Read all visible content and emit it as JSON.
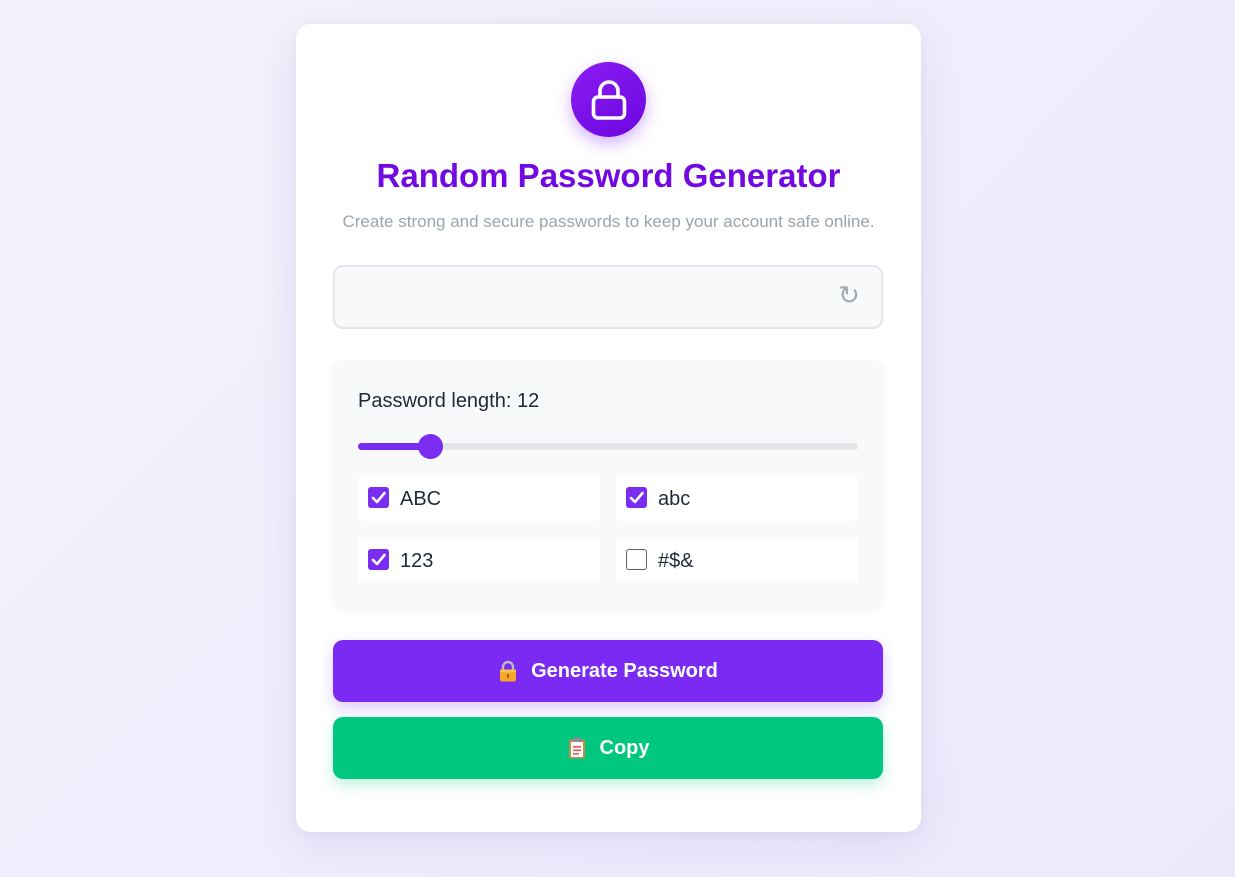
{
  "header": {
    "logo_icon": "lock-icon",
    "title": "Random Password Generator",
    "subtitle": "Create strong and secure passwords to keep your account safe online."
  },
  "password": {
    "value": "",
    "placeholder": "",
    "refresh_icon": "refresh-icon",
    "refresh_glyph": "↻"
  },
  "length": {
    "label": "Password length: 12",
    "value": 12,
    "fraction": 0.143
  },
  "options": [
    {
      "label": "ABC",
      "checked": true
    },
    {
      "label": "abc",
      "checked": true
    },
    {
      "label": "123",
      "checked": true
    },
    {
      "label": "#$&",
      "checked": false
    }
  ],
  "buttons": {
    "generate_label": "Generate Password",
    "generate_icon": "lock-emoji-icon",
    "copy_label": "Copy",
    "copy_icon": "clipboard-icon"
  },
  "colors": {
    "accent": "#7b2cf1",
    "title": "#7209e3",
    "copy": "#00c77f"
  }
}
